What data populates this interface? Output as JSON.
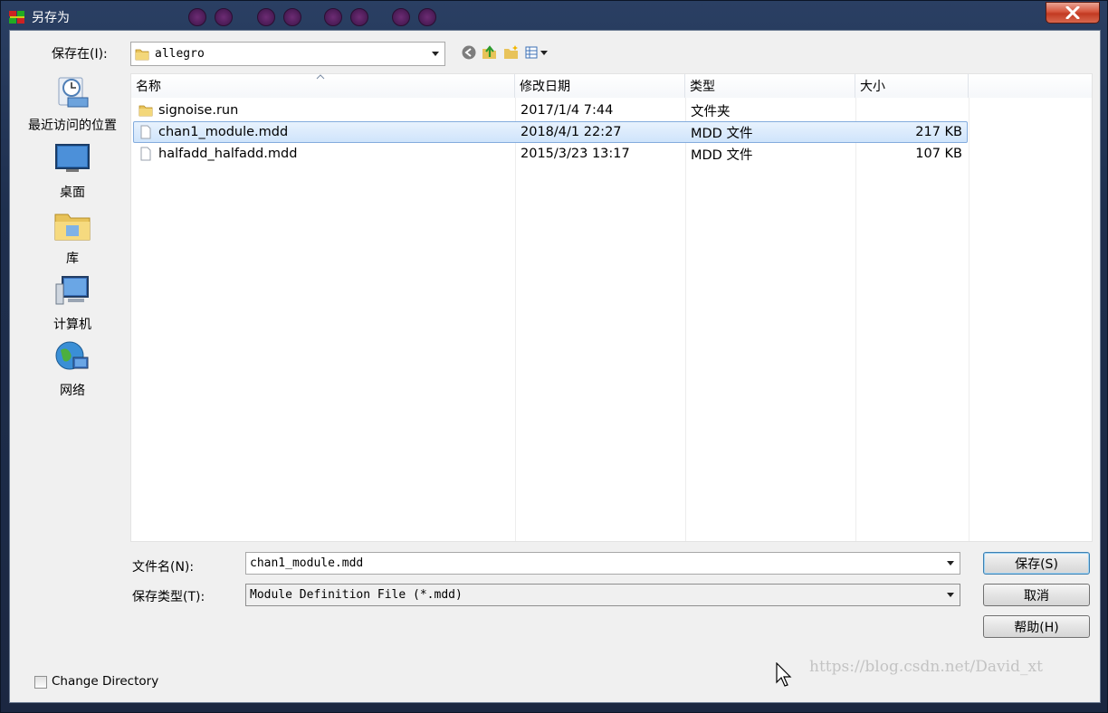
{
  "window": {
    "title": "另存为",
    "close_symbol": "✕"
  },
  "location": {
    "label": "保存在(I):",
    "current_folder": "allegro"
  },
  "places": [
    {
      "label": "最近访问的位置",
      "icon": "recent-places-icon"
    },
    {
      "label": "桌面",
      "icon": "desktop-icon"
    },
    {
      "label": "库",
      "icon": "libraries-icon"
    },
    {
      "label": "计算机",
      "icon": "computer-icon"
    },
    {
      "label": "网络",
      "icon": "network-icon"
    }
  ],
  "columns": {
    "name": "名称",
    "date": "修改日期",
    "type": "类型",
    "size": "大小"
  },
  "files": [
    {
      "name": "signoise.run",
      "date": "2017/1/4 7:44",
      "type": "文件夹",
      "size": "",
      "icon": "folder-icon"
    },
    {
      "name": "chan1_module.mdd",
      "date": "2018/4/1 22:27",
      "type": "MDD 文件",
      "size": "217 KB",
      "icon": "file-icon",
      "selected": true
    },
    {
      "name": "halfadd_halfadd.mdd",
      "date": "2015/3/23 13:17",
      "type": "MDD 文件",
      "size": "107 KB",
      "icon": "file-icon"
    }
  ],
  "filename": {
    "label": "文件名(N):",
    "value": "chan1_module.mdd"
  },
  "filetype": {
    "label": "保存类型(T):",
    "value": "Module Definition File (*.mdd)"
  },
  "buttons": {
    "save": "保存(S)",
    "cancel": "取消",
    "help": "帮助(H)"
  },
  "change_directory": {
    "label": "Change Directory",
    "checked": false
  },
  "watermark": "https://blog.csdn.net/David_xt"
}
